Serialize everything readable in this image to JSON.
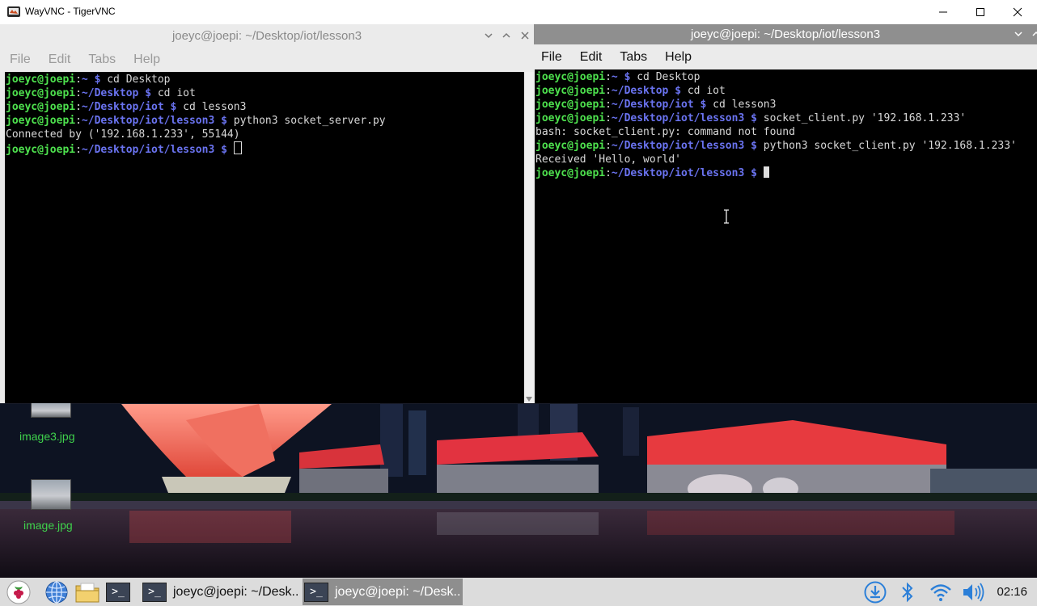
{
  "vnc_window": {
    "title": "WayVNC - TigerVNC",
    "minimize_icon": "minimize-icon",
    "maximize_icon": "maximize-icon",
    "close_icon": "close-icon"
  },
  "terminal_left": {
    "title": "joeyc@joepi: ~/Desktop/iot/lesson3",
    "menu": [
      "File",
      "Edit",
      "Tabs",
      "Help"
    ],
    "lines": [
      {
        "user": "joeyc@joepi",
        "sep": ":",
        "path": "~",
        "prompt": " $ ",
        "text": "cd Desktop"
      },
      {
        "user": "joeyc@joepi",
        "sep": ":",
        "path": "~/Desktop",
        "prompt": " $ ",
        "text": "cd iot"
      },
      {
        "user": "joeyc@joepi",
        "sep": ":",
        "path": "~/Desktop/iot",
        "prompt": " $ ",
        "text": "cd lesson3"
      },
      {
        "user": "joeyc@joepi",
        "sep": ":",
        "path": "~/Desktop/iot/lesson3",
        "prompt": " $ ",
        "text": "python3 socket_server.py"
      },
      {
        "output": "Connected by ('192.168.1.233', 55144)"
      },
      {
        "user": "joeyc@joepi",
        "sep": ":",
        "path": "~/Desktop/iot/lesson3",
        "prompt": " $ ",
        "text": "",
        "cursor": "hollow"
      }
    ]
  },
  "terminal_right": {
    "title": "joeyc@joepi: ~/Desktop/iot/lesson3",
    "menu": [
      "File",
      "Edit",
      "Tabs",
      "Help"
    ],
    "lines": [
      {
        "user": "joeyc@joepi",
        "sep": ":",
        "path": "~",
        "prompt": " $ ",
        "text": "cd Desktop"
      },
      {
        "user": "joeyc@joepi",
        "sep": ":",
        "path": "~/Desktop",
        "prompt": " $ ",
        "text": "cd iot"
      },
      {
        "user": "joeyc@joepi",
        "sep": ":",
        "path": "~/Desktop/iot",
        "prompt": " $ ",
        "text": "cd lesson3"
      },
      {
        "user": "joeyc@joepi",
        "sep": ":",
        "path": "~/Desktop/iot/lesson3",
        "prompt": " $ ",
        "text": "socket_client.py '192.168.1.233'"
      },
      {
        "output": "bash: socket_client.py: command not found"
      },
      {
        "user": "joeyc@joepi",
        "sep": ":",
        "path": "~/Desktop/iot/lesson3",
        "prompt": " $ ",
        "text": "python3 socket_client.py '192.168.1.233'"
      },
      {
        "output": "Received 'Hello, world'"
      },
      {
        "user": "joeyc@joepi",
        "sep": ":",
        "path": "~/Desktop/iot/lesson3",
        "prompt": " $ ",
        "text": "",
        "cursor": "filled"
      }
    ]
  },
  "desktop": {
    "icons": [
      {
        "label": "image3.jpg"
      },
      {
        "label": "image.jpg"
      }
    ]
  },
  "taskbar": {
    "tasks": [
      {
        "label": "joeyc@joepi: ~/Desk..",
        "active": false
      },
      {
        "label": "joeyc@joepi: ~/Desk..",
        "active": true
      }
    ],
    "clock": "02:16"
  },
  "colors": {
    "user": "#4ee24e",
    "path": "#6a73f0",
    "output": "#d8d8d8",
    "taskbar": "#dcdcdc",
    "desktop_label": "#3fd24c"
  }
}
